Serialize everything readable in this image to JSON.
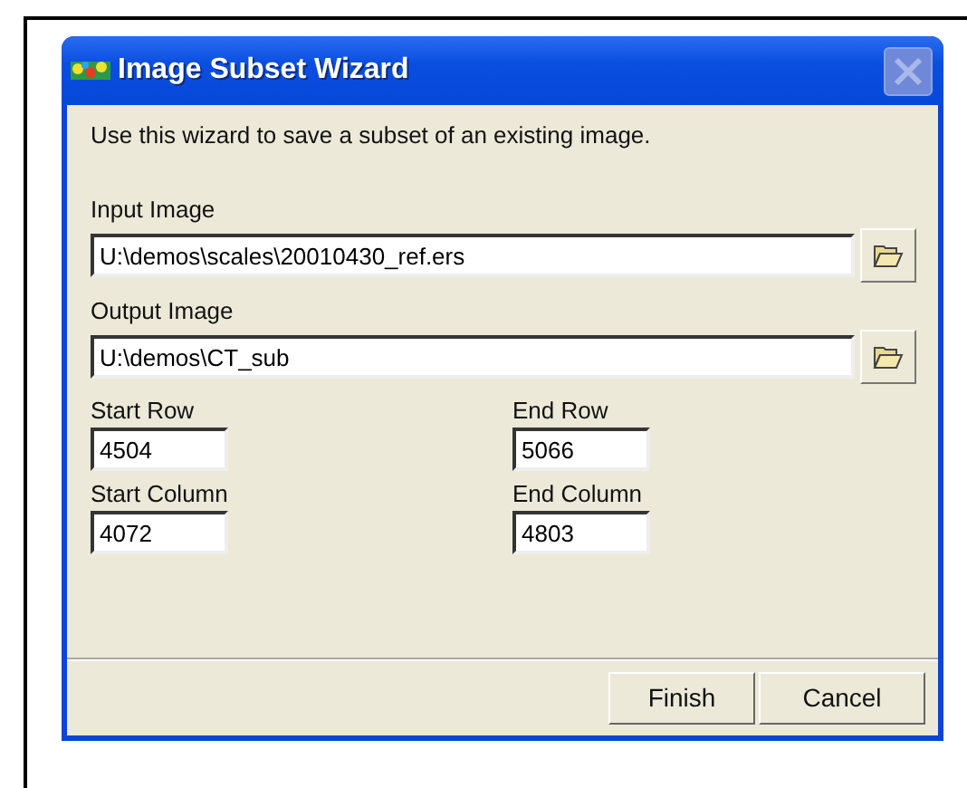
{
  "window": {
    "title": "Image Subset Wizard",
    "close_disabled": true
  },
  "description": "Use this wizard to save a subset of an existing image.",
  "file_fields": [
    {
      "label": "Input Image",
      "value": "U:\\demos\\scales\\20010430_ref.ers"
    },
    {
      "label": "Output Image",
      "value": "U:\\demos\\CT_sub"
    }
  ],
  "number_fields": [
    {
      "label": "Start Row",
      "value": "4504"
    },
    {
      "label": "End Row",
      "value": "5066"
    },
    {
      "label": "Start Column",
      "value": "4072"
    },
    {
      "label": "End Column",
      "value": "4803"
    }
  ],
  "buttons": [
    "Finish",
    "Cancel"
  ]
}
